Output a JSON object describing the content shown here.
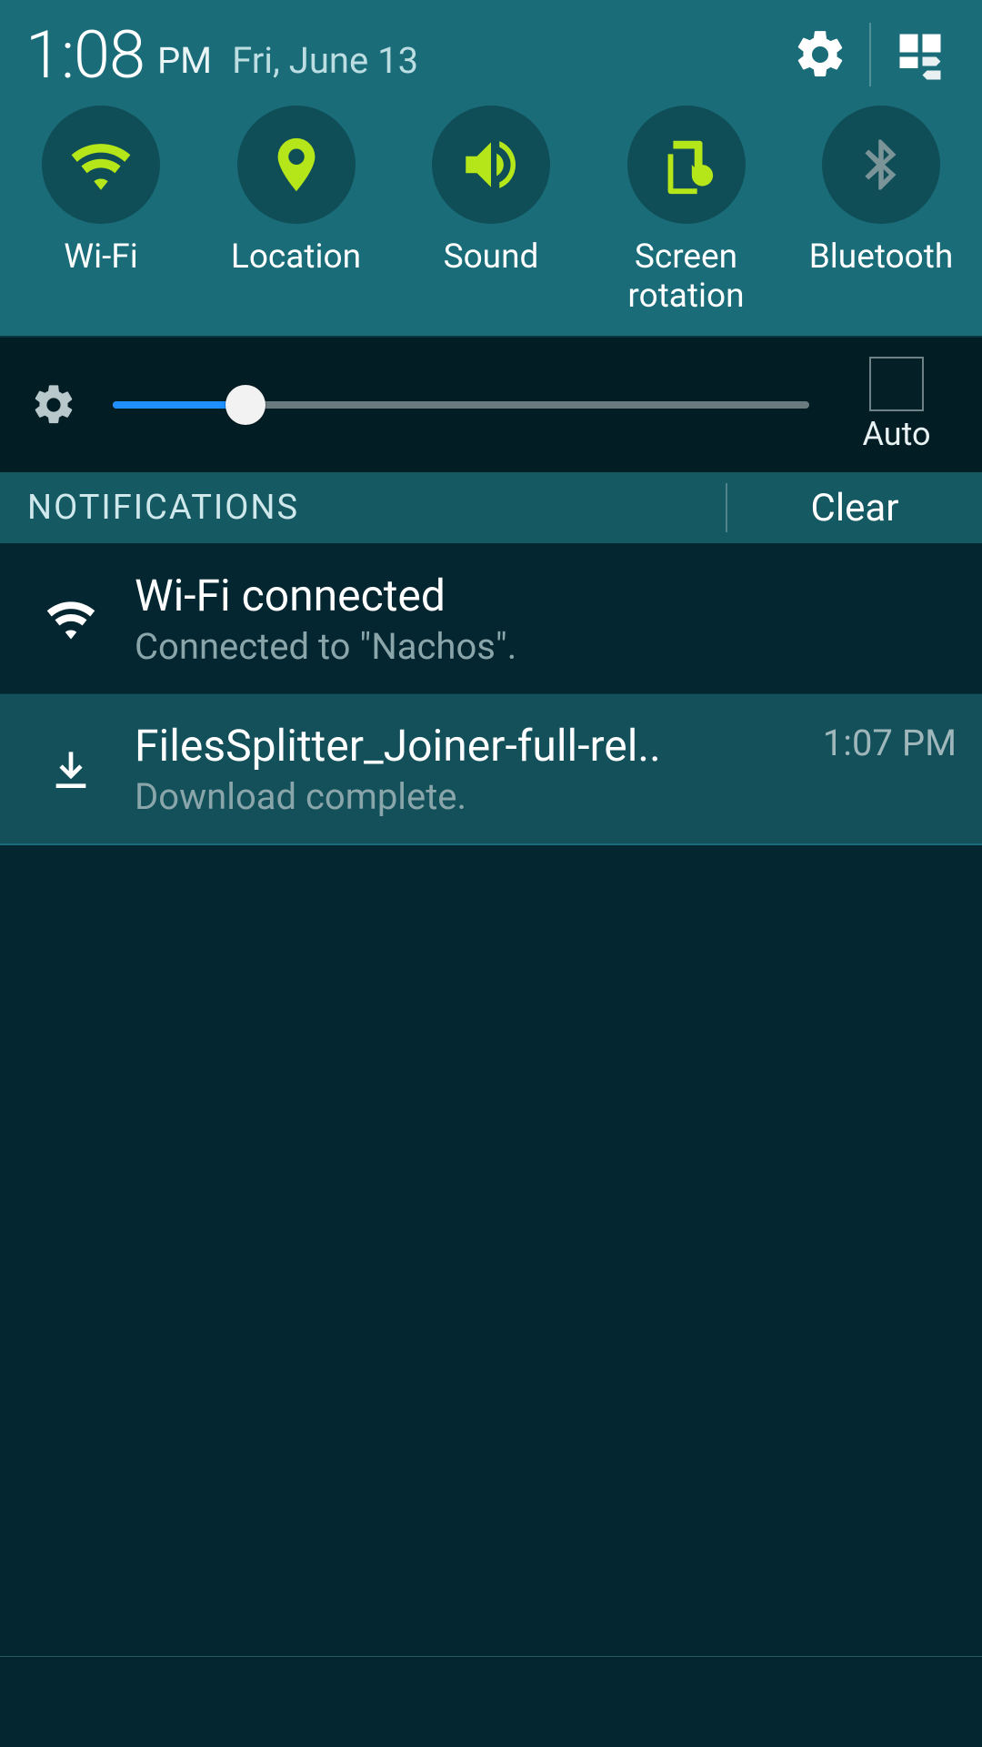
{
  "status": {
    "time": "1:08",
    "ampm": "PM",
    "date": "Fri, June 13"
  },
  "quick_toggles": [
    {
      "label": "Wi-Fi",
      "active": true
    },
    {
      "label": "Location",
      "active": true
    },
    {
      "label": "Sound",
      "active": true
    },
    {
      "label": "Screen\nrotation",
      "active": true
    },
    {
      "label": "Bluetooth",
      "active": false
    }
  ],
  "brightness": {
    "percent": 19,
    "auto_label": "Auto",
    "auto_checked": false
  },
  "notifications_header": {
    "title": "NOTIFICATIONS",
    "clear_label": "Clear"
  },
  "notifications": [
    {
      "title": "Wi-Fi connected",
      "subtitle": "Connected to \"Nachos\".",
      "time": "",
      "icon": "wifi",
      "selected": false
    },
    {
      "title": "FilesSplitter_Joiner-full-rel..",
      "subtitle": "Download complete.",
      "time": "1:07 PM",
      "icon": "download",
      "selected": true
    }
  ]
}
